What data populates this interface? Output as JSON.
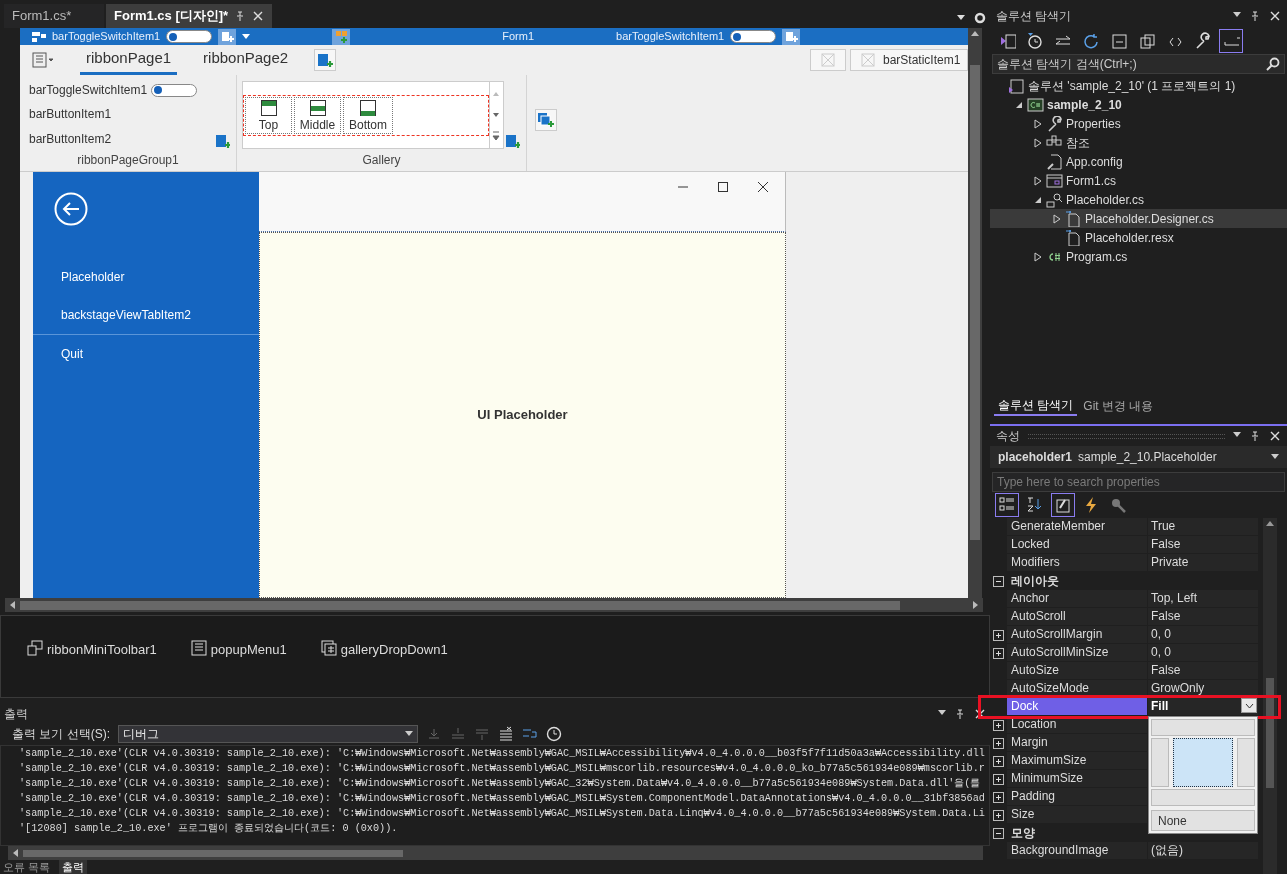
{
  "editor_tabs": [
    {
      "label": "Form1.cs*",
      "selected": false
    },
    {
      "label": "Form1.cs [디자인]*",
      "selected": true
    }
  ],
  "form": {
    "title_bar": {
      "left_item": "barToggleSwitchItem1",
      "left_on": false,
      "title": "Form1",
      "right_item": "barToggleSwitchItem1",
      "right_on": false
    },
    "ribbon": {
      "pages": [
        {
          "label": "ribbonPage1",
          "selected": true
        },
        {
          "label": "ribbonPage2",
          "selected": false
        }
      ],
      "static_item": "barStaticItem1",
      "group": {
        "caption": "ribbonPageGroup1",
        "items": [
          {
            "kind": "toggle",
            "label": "barToggleSwitchItem1",
            "on": false
          },
          {
            "kind": "button",
            "label": "barButtonItem1"
          },
          {
            "kind": "button",
            "label": "barButtonItem2"
          }
        ]
      },
      "gallery": {
        "caption": "Gallery",
        "items": [
          "Top",
          "Middle",
          "Bottom"
        ]
      }
    },
    "backstage": {
      "items": [
        {
          "kind": "tab",
          "label": "Placeholder"
        },
        {
          "kind": "tab",
          "label": "backstageViewTabItem2"
        },
        {
          "kind": "button",
          "label": "Quit"
        }
      ],
      "content": "UI Placeholder"
    }
  },
  "tray": [
    "ribbonMiniToolbar1",
    "popupMenu1",
    "galleryDropDown1"
  ],
  "output": {
    "title": "출력",
    "selector_label": "출력 보기 선택(S):",
    "selector_value": "디버그",
    "lines": [
      "'sample_2_10.exe'(CLR v4.0.30319: sample_2_10.exe): 'C:₩Windows₩Microsoft.Net₩assembly₩GAC_MSIL₩Accessibility₩v4.0_4.0.0.0__b03f5f7f11d50a3a₩Accessibility.dll",
      "'sample_2_10.exe'(CLR v4.0.30319: sample_2_10.exe): 'C:₩Windows₩Microsoft.Net₩assembly₩GAC_MSIL₩mscorlib.resources₩v4.0_4.0.0.0_ko_b77a5c561934e089₩mscorlib.r",
      "'sample_2_10.exe'(CLR v4.0.30319: sample_2_10.exe): 'C:₩Windows₩Microsoft.Net₩assembly₩GAC_32₩System.Data₩v4.0_4.0.0.0__b77a5c561934e089₩System.Data.dll'을(를",
      "'sample_2_10.exe'(CLR v4.0.30319: sample_2_10.exe): 'C:₩Windows₩Microsoft.Net₩assembly₩GAC_MSIL₩System.ComponentModel.DataAnnotations₩v4.0_4.0.0.0__31bf3856ad",
      "'sample_2_10.exe'(CLR v4.0.30319: sample_2_10.exe): 'C:₩Windows₩Microsoft.Net₩assembly₩GAC_MSIL₩System.Data.Linq₩v4.0_4.0.0.0__b77a5c561934e089₩System.Data.Li",
      "'[12080] sample_2_10.exe' 프로그램이 종료되었습니다(코드: 0 (0x0))."
    ],
    "bottom_tabs": [
      {
        "label": "오류 목록",
        "selected": false
      },
      {
        "label": "출력",
        "selected": true
      }
    ]
  },
  "solution_explorer": {
    "title": "솔루션 탐색기",
    "search_placeholder": "솔루션 탐색기 검색(Ctrl+;)",
    "tree": [
      {
        "kind": "solution",
        "label": "솔루션 'sample_2_10' (1 프로젝트의 1)",
        "selected": false,
        "children": [
          {
            "kind": "project",
            "label": "sample_2_10",
            "expanded": true,
            "selected": false,
            "children": [
              {
                "kind": "properties",
                "label": "Properties",
                "expanded": false,
                "selected": false
              },
              {
                "kind": "references",
                "label": "참조",
                "expanded": false,
                "selected": false
              },
              {
                "kind": "config",
                "label": "App.config",
                "selected": false
              },
              {
                "kind": "form",
                "label": "Form1.cs",
                "expanded": false,
                "selected": false
              },
              {
                "kind": "class",
                "label": "Placeholder.cs",
                "expanded": true,
                "selected": false,
                "children": [
                  {
                    "kind": "file",
                    "label": "Placeholder.Designer.cs",
                    "expanded": false,
                    "selected": true
                  },
                  {
                    "kind": "file",
                    "label": "Placeholder.resx",
                    "selected": false
                  }
                ]
              },
              {
                "kind": "csharp",
                "label": "Program.cs",
                "expanded": false,
                "selected": false
              }
            ]
          }
        ]
      }
    ],
    "tabs": [
      {
        "label": "솔루션 탐색기",
        "selected": true
      },
      {
        "label": "Git 변경 내용",
        "selected": false
      }
    ]
  },
  "properties": {
    "title": "속성",
    "object_name": "placeholder1",
    "object_type": "sample_2_10.Placeholder",
    "search_placeholder": "Type here to search properties",
    "rows": [
      {
        "kind": "property",
        "name": "GenerateMember",
        "value": "True",
        "expandable": false,
        "selected": false
      },
      {
        "kind": "property",
        "name": "Locked",
        "value": "False",
        "expandable": false,
        "selected": false
      },
      {
        "kind": "property",
        "name": "Modifiers",
        "value": "Private",
        "expandable": false,
        "selected": false
      },
      {
        "kind": "category",
        "name": "레이아웃",
        "expanded": true
      },
      {
        "kind": "property",
        "name": "Anchor",
        "value": "Top, Left",
        "expandable": false,
        "selected": false
      },
      {
        "kind": "property",
        "name": "AutoScroll",
        "value": "False",
        "expandable": false,
        "selected": false
      },
      {
        "kind": "property",
        "name": "AutoScrollMargin",
        "value": "0, 0",
        "expandable": true,
        "selected": false
      },
      {
        "kind": "property",
        "name": "AutoScrollMinSize",
        "value": "0, 0",
        "expandable": true,
        "selected": false
      },
      {
        "kind": "property",
        "name": "AutoSize",
        "value": "False",
        "expandable": false,
        "selected": false
      },
      {
        "kind": "property",
        "name": "AutoSizeMode",
        "value": "GrowOnly",
        "expandable": false,
        "selected": false
      },
      {
        "kind": "property",
        "name": "Dock",
        "value": "Fill",
        "expandable": false,
        "selected": true
      },
      {
        "kind": "property",
        "name": "Location",
        "expandable": true,
        "selected": false
      },
      {
        "kind": "property",
        "name": "Margin",
        "expandable": true,
        "selected": false
      },
      {
        "kind": "property",
        "name": "MaximumSize",
        "expandable": true,
        "selected": false
      },
      {
        "kind": "property",
        "name": "MinimumSize",
        "expandable": true,
        "selected": false
      },
      {
        "kind": "property",
        "name": "Padding",
        "expandable": true,
        "selected": false
      },
      {
        "kind": "property",
        "name": "Size",
        "expandable": true,
        "selected": false
      },
      {
        "kind": "category",
        "name": "모양",
        "expanded": true
      },
      {
        "kind": "property",
        "name": "BackgroundImage",
        "value": "(없음)",
        "expandable": false,
        "selected": false
      }
    ],
    "dock_editor": [
      {
        "kind": "top",
        "selected": false
      },
      {
        "kind": "left",
        "selected": false
      },
      {
        "kind": "fill",
        "selected": true
      },
      {
        "kind": "right",
        "selected": false
      },
      {
        "kind": "bottom",
        "selected": false
      },
      {
        "kind": "none",
        "label": "None",
        "selected": false
      }
    ]
  }
}
